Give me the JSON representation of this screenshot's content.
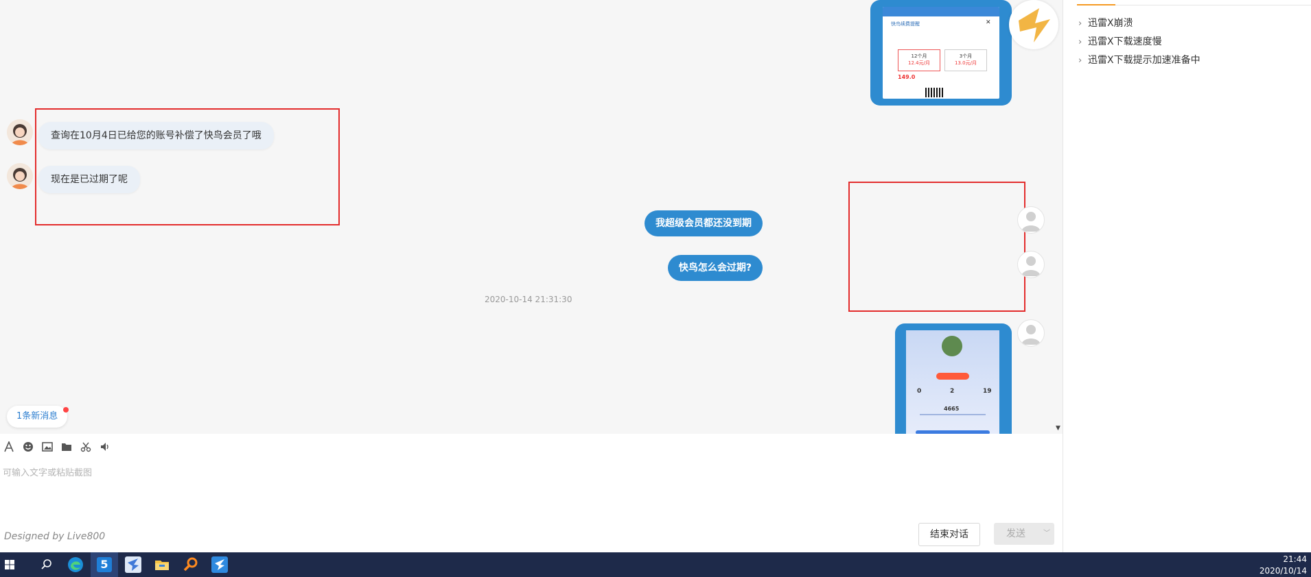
{
  "faq": {
    "items": [
      {
        "label": "迅雷X崩溃"
      },
      {
        "label": "迅雷X下载速度慢"
      },
      {
        "label": "迅雷X下载提示加速准备中"
      }
    ]
  },
  "chat": {
    "agent_messages": [
      {
        "text": "查询在10月4日已给您的账号补偿了快鸟会员了哦"
      },
      {
        "text": "现在是已过期了呢"
      }
    ],
    "user_messages": [
      {
        "text": "我超级会员都还没到期"
      },
      {
        "text": "快鸟怎么会过期?"
      }
    ],
    "timestamp": "2020-10-14 21:31:30",
    "new_message_badge": "1条新消息",
    "vip_popup": {
      "title": "快鸟续费提醒",
      "plan_a": "12个月",
      "plan_a_price": "12.4元/月",
      "plan_b": "3个月",
      "plan_b_price": "13.0元/月",
      "total": "149.0"
    },
    "profile_card": {
      "count_left": "0",
      "count_mid": "2",
      "count_right": "19",
      "score": "4665"
    }
  },
  "composer": {
    "placeholder": "可输入文字或粘贴截图",
    "credit": "Designed by Live800",
    "end_label": "结束对话",
    "send_label": "发送"
  },
  "taskbar": {
    "time": "21:44",
    "date": "2020/10/14"
  },
  "colors": {
    "accent": "#2e8bd0",
    "redbox": "#e32b2b",
    "taskbar": "#1e2a4a"
  }
}
